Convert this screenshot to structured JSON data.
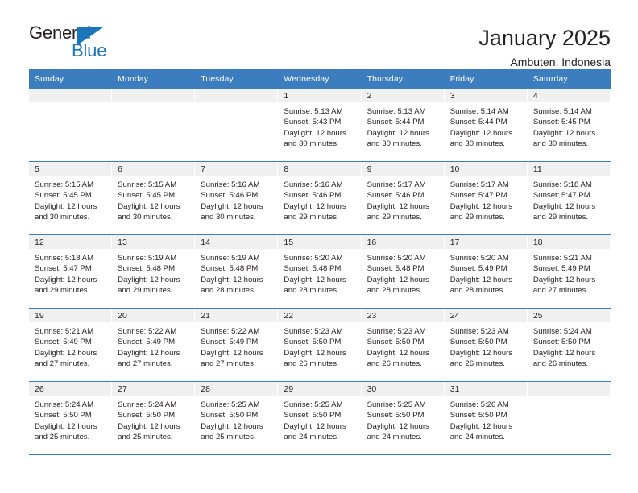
{
  "brand": {
    "name_dark": "General",
    "name_blue": "Blue",
    "accent_color": "#1b75bb"
  },
  "header": {
    "title": "January 2025",
    "location": "Ambuten, Indonesia"
  },
  "calendar": {
    "header_bg": "#3b7dbf",
    "daynum_bg": "#f0f0f0",
    "weekdays": [
      "Sunday",
      "Monday",
      "Tuesday",
      "Wednesday",
      "Thursday",
      "Friday",
      "Saturday"
    ],
    "weeks": [
      [
        {
          "day": "",
          "sunrise": "",
          "sunset": "",
          "daylight1": "",
          "daylight2": ""
        },
        {
          "day": "",
          "sunrise": "",
          "sunset": "",
          "daylight1": "",
          "daylight2": ""
        },
        {
          "day": "",
          "sunrise": "",
          "sunset": "",
          "daylight1": "",
          "daylight2": ""
        },
        {
          "day": "1",
          "sunrise": "Sunrise: 5:13 AM",
          "sunset": "Sunset: 5:43 PM",
          "daylight1": "Daylight: 12 hours",
          "daylight2": "and 30 minutes."
        },
        {
          "day": "2",
          "sunrise": "Sunrise: 5:13 AM",
          "sunset": "Sunset: 5:44 PM",
          "daylight1": "Daylight: 12 hours",
          "daylight2": "and 30 minutes."
        },
        {
          "day": "3",
          "sunrise": "Sunrise: 5:14 AM",
          "sunset": "Sunset: 5:44 PM",
          "daylight1": "Daylight: 12 hours",
          "daylight2": "and 30 minutes."
        },
        {
          "day": "4",
          "sunrise": "Sunrise: 5:14 AM",
          "sunset": "Sunset: 5:45 PM",
          "daylight1": "Daylight: 12 hours",
          "daylight2": "and 30 minutes."
        }
      ],
      [
        {
          "day": "5",
          "sunrise": "Sunrise: 5:15 AM",
          "sunset": "Sunset: 5:45 PM",
          "daylight1": "Daylight: 12 hours",
          "daylight2": "and 30 minutes."
        },
        {
          "day": "6",
          "sunrise": "Sunrise: 5:15 AM",
          "sunset": "Sunset: 5:45 PM",
          "daylight1": "Daylight: 12 hours",
          "daylight2": "and 30 minutes."
        },
        {
          "day": "7",
          "sunrise": "Sunrise: 5:16 AM",
          "sunset": "Sunset: 5:46 PM",
          "daylight1": "Daylight: 12 hours",
          "daylight2": "and 30 minutes."
        },
        {
          "day": "8",
          "sunrise": "Sunrise: 5:16 AM",
          "sunset": "Sunset: 5:46 PM",
          "daylight1": "Daylight: 12 hours",
          "daylight2": "and 29 minutes."
        },
        {
          "day": "9",
          "sunrise": "Sunrise: 5:17 AM",
          "sunset": "Sunset: 5:46 PM",
          "daylight1": "Daylight: 12 hours",
          "daylight2": "and 29 minutes."
        },
        {
          "day": "10",
          "sunrise": "Sunrise: 5:17 AM",
          "sunset": "Sunset: 5:47 PM",
          "daylight1": "Daylight: 12 hours",
          "daylight2": "and 29 minutes."
        },
        {
          "day": "11",
          "sunrise": "Sunrise: 5:18 AM",
          "sunset": "Sunset: 5:47 PM",
          "daylight1": "Daylight: 12 hours",
          "daylight2": "and 29 minutes."
        }
      ],
      [
        {
          "day": "12",
          "sunrise": "Sunrise: 5:18 AM",
          "sunset": "Sunset: 5:47 PM",
          "daylight1": "Daylight: 12 hours",
          "daylight2": "and 29 minutes."
        },
        {
          "day": "13",
          "sunrise": "Sunrise: 5:19 AM",
          "sunset": "Sunset: 5:48 PM",
          "daylight1": "Daylight: 12 hours",
          "daylight2": "and 29 minutes."
        },
        {
          "day": "14",
          "sunrise": "Sunrise: 5:19 AM",
          "sunset": "Sunset: 5:48 PM",
          "daylight1": "Daylight: 12 hours",
          "daylight2": "and 28 minutes."
        },
        {
          "day": "15",
          "sunrise": "Sunrise: 5:20 AM",
          "sunset": "Sunset: 5:48 PM",
          "daylight1": "Daylight: 12 hours",
          "daylight2": "and 28 minutes."
        },
        {
          "day": "16",
          "sunrise": "Sunrise: 5:20 AM",
          "sunset": "Sunset: 5:48 PM",
          "daylight1": "Daylight: 12 hours",
          "daylight2": "and 28 minutes."
        },
        {
          "day": "17",
          "sunrise": "Sunrise: 5:20 AM",
          "sunset": "Sunset: 5:49 PM",
          "daylight1": "Daylight: 12 hours",
          "daylight2": "and 28 minutes."
        },
        {
          "day": "18",
          "sunrise": "Sunrise: 5:21 AM",
          "sunset": "Sunset: 5:49 PM",
          "daylight1": "Daylight: 12 hours",
          "daylight2": "and 27 minutes."
        }
      ],
      [
        {
          "day": "19",
          "sunrise": "Sunrise: 5:21 AM",
          "sunset": "Sunset: 5:49 PM",
          "daylight1": "Daylight: 12 hours",
          "daylight2": "and 27 minutes."
        },
        {
          "day": "20",
          "sunrise": "Sunrise: 5:22 AM",
          "sunset": "Sunset: 5:49 PM",
          "daylight1": "Daylight: 12 hours",
          "daylight2": "and 27 minutes."
        },
        {
          "day": "21",
          "sunrise": "Sunrise: 5:22 AM",
          "sunset": "Sunset: 5:49 PM",
          "daylight1": "Daylight: 12 hours",
          "daylight2": "and 27 minutes."
        },
        {
          "day": "22",
          "sunrise": "Sunrise: 5:23 AM",
          "sunset": "Sunset: 5:50 PM",
          "daylight1": "Daylight: 12 hours",
          "daylight2": "and 26 minutes."
        },
        {
          "day": "23",
          "sunrise": "Sunrise: 5:23 AM",
          "sunset": "Sunset: 5:50 PM",
          "daylight1": "Daylight: 12 hours",
          "daylight2": "and 26 minutes."
        },
        {
          "day": "24",
          "sunrise": "Sunrise: 5:23 AM",
          "sunset": "Sunset: 5:50 PM",
          "daylight1": "Daylight: 12 hours",
          "daylight2": "and 26 minutes."
        },
        {
          "day": "25",
          "sunrise": "Sunrise: 5:24 AM",
          "sunset": "Sunset: 5:50 PM",
          "daylight1": "Daylight: 12 hours",
          "daylight2": "and 26 minutes."
        }
      ],
      [
        {
          "day": "26",
          "sunrise": "Sunrise: 5:24 AM",
          "sunset": "Sunset: 5:50 PM",
          "daylight1": "Daylight: 12 hours",
          "daylight2": "and 25 minutes."
        },
        {
          "day": "27",
          "sunrise": "Sunrise: 5:24 AM",
          "sunset": "Sunset: 5:50 PM",
          "daylight1": "Daylight: 12 hours",
          "daylight2": "and 25 minutes."
        },
        {
          "day": "28",
          "sunrise": "Sunrise: 5:25 AM",
          "sunset": "Sunset: 5:50 PM",
          "daylight1": "Daylight: 12 hours",
          "daylight2": "and 25 minutes."
        },
        {
          "day": "29",
          "sunrise": "Sunrise: 5:25 AM",
          "sunset": "Sunset: 5:50 PM",
          "daylight1": "Daylight: 12 hours",
          "daylight2": "and 24 minutes."
        },
        {
          "day": "30",
          "sunrise": "Sunrise: 5:25 AM",
          "sunset": "Sunset: 5:50 PM",
          "daylight1": "Daylight: 12 hours",
          "daylight2": "and 24 minutes."
        },
        {
          "day": "31",
          "sunrise": "Sunrise: 5:26 AM",
          "sunset": "Sunset: 5:50 PM",
          "daylight1": "Daylight: 12 hours",
          "daylight2": "and 24 minutes."
        },
        {
          "day": "",
          "sunrise": "",
          "sunset": "",
          "daylight1": "",
          "daylight2": ""
        }
      ]
    ]
  }
}
